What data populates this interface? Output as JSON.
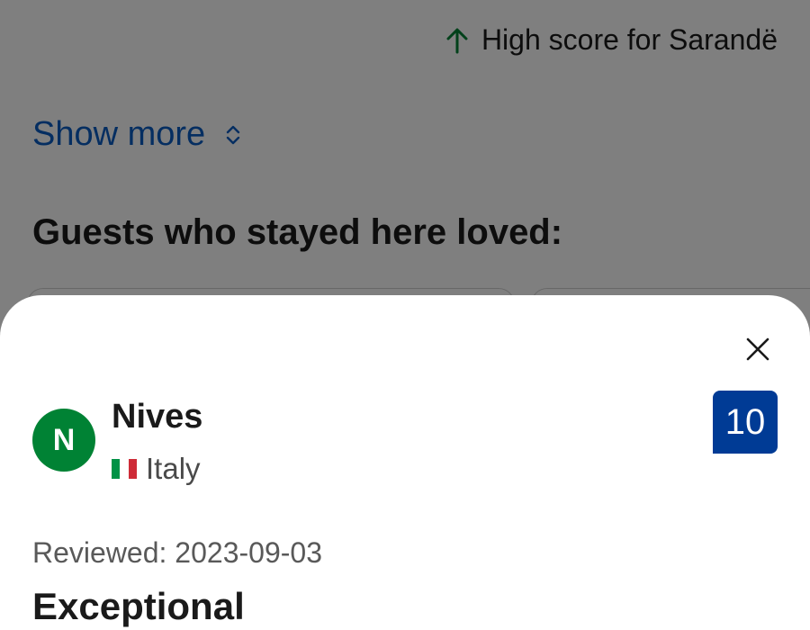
{
  "background": {
    "high_score_text": "High score for Sarandë",
    "show_more_label": "Show more",
    "guests_loved_heading": "Guests who stayed here loved:"
  },
  "review": {
    "avatar_initial": "N",
    "reviewer_name": "Nives",
    "country": "Italy",
    "score": "10",
    "reviewed_date": "Reviewed: 2023-09-03",
    "title": "Exceptional"
  },
  "colors": {
    "avatar": "#008234",
    "score_badge": "#003b95",
    "link": "#0a5cc2",
    "up_arrow": "#008234"
  },
  "icons": {
    "high_score": "arrow-up-icon",
    "show_more": "chevron-updown-icon",
    "close": "close-icon",
    "country": "italy-flag-icon"
  }
}
